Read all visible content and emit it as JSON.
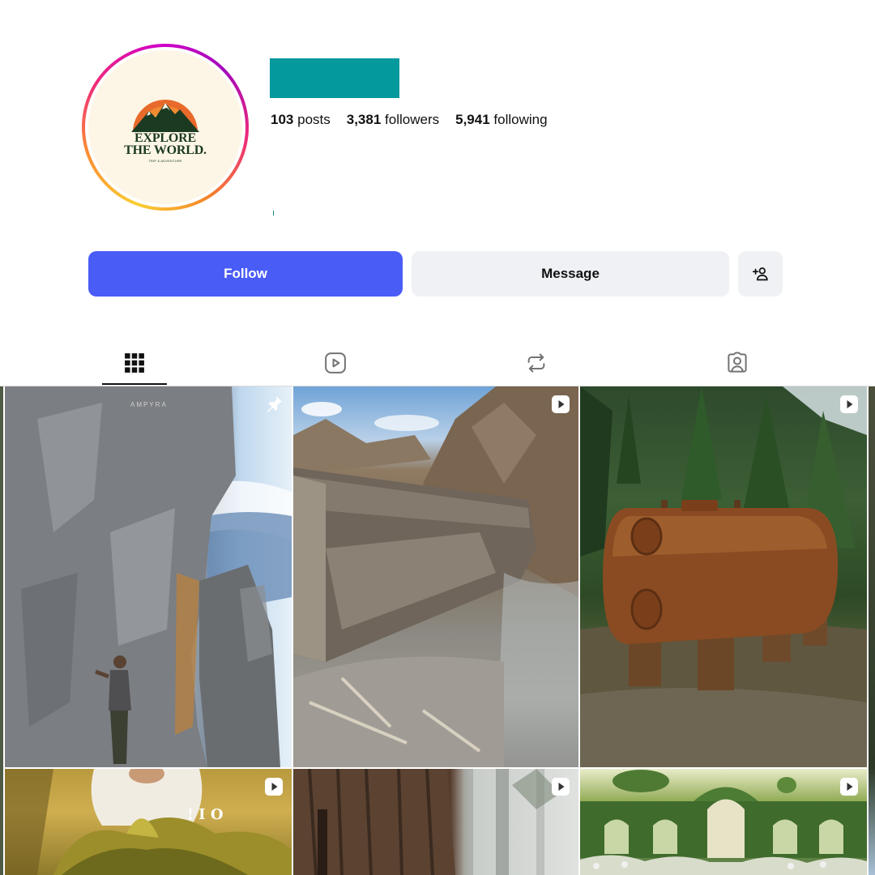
{
  "profile": {
    "avatar": {
      "logo_title_line1": "EXPLORE",
      "logo_title_line2": "THE WORLD.",
      "logo_subtitle": "TRIP & ADVENTURE"
    },
    "username_redacted_color": "#04999d",
    "stats": {
      "posts_count": "103",
      "posts_label": "posts",
      "followers_count": "3,381",
      "followers_label": "followers",
      "following_count": "5,941",
      "following_label": "following"
    }
  },
  "actions": {
    "follow_label": "Follow",
    "message_label": "Message",
    "add_user_icon": "person-add-icon"
  },
  "tabs": [
    {
      "icon": "grid-icon",
      "active": true
    },
    {
      "icon": "reels-icon",
      "active": false
    },
    {
      "icon": "reposts-icon",
      "active": false
    },
    {
      "icon": "tagged-icon",
      "active": false
    }
  ],
  "posts": [
    {
      "scene": "climber on rocky cliff face above clouds",
      "badge": "pin-icon",
      "watermark": "AMPYRA"
    },
    {
      "scene": "fallen log across rocky mountain stream",
      "badge": "reel-icon"
    },
    {
      "scene": "rusty tank in forest",
      "badge": "reel-icon"
    },
    {
      "scene": "person with moss and grass",
      "badge": "reel-icon"
    },
    {
      "scene": "giant tree trunk in misty forest",
      "badge": "reel-icon"
    },
    {
      "scene": "topiary hedge archways in garden",
      "badge": "reel-icon"
    }
  ],
  "colors": {
    "follow_button": "#4a5cf6",
    "secondary_button": "#eff1f4"
  }
}
